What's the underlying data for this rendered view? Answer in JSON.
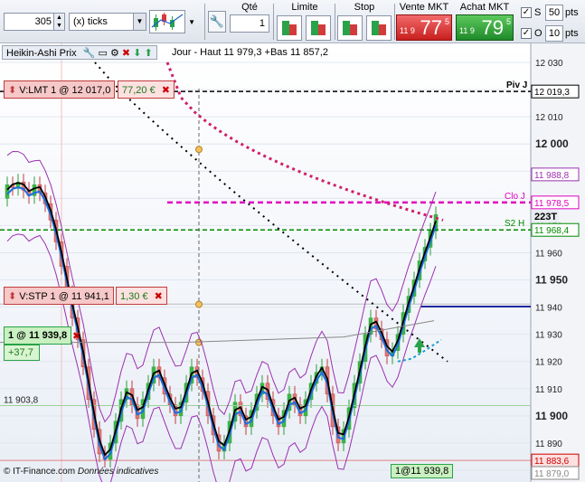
{
  "toolbar": {
    "period_value": "305",
    "period_unit": "(x) ticks",
    "qty_label": "Qté",
    "qty_value": "1",
    "limit_label": "Limite",
    "stop_label": "Stop",
    "sell_label": "Vente MKT",
    "sell_small": "11 9",
    "sell_big": "77",
    "sell_sup": "5",
    "buy_label": "Achat MKT",
    "buy_small": "11 9",
    "buy_big": "79",
    "buy_sup": "5",
    "s_label": "S",
    "s_value": "50",
    "s_unit": "pts",
    "o_label": "O",
    "o_value": "10",
    "o_unit": "pts",
    "check_mark": "✓"
  },
  "legend": {
    "title": "Heikin-Ashi Prix",
    "info": "Jour - Haut 11 979,3 +Bas 11 857,2"
  },
  "orders": {
    "lmt_text": "V:LMT  1 @ 12 017,0",
    "lmt_val": "77,20 €",
    "stp_text": "V:STP  1 @ 11 941,1",
    "stp_val": "1,30 €",
    "pos_text": "1 @ 11 939,8",
    "pos_val": "+37,7",
    "pos_badge": "1@11 939,8",
    "close_glyph": "✖"
  },
  "axis": {
    "ticks": [
      "12 030",
      "12 020",
      "12 010",
      "12 000",
      "11 990",
      "11 980",
      "11 970",
      "11 960",
      "11 950",
      "11 940",
      "11 930",
      "11 920",
      "11 910",
      "11 900",
      "11 890",
      "11 880"
    ],
    "price_tags": [
      "12 019,3",
      "11 988,8",
      "11 978,5",
      "11 968,4",
      "11 883,6",
      "11 879,0",
      "11 903,8",
      "223T"
    ],
    "line_labels": [
      "Piv J",
      "Clo J",
      "S2 H"
    ]
  },
  "footer": {
    "brand": "© IT-Finance.com",
    "note": "Données indicatives"
  },
  "colors": {
    "sell": "#d23b3b",
    "buy": "#2aa24a",
    "ha_up": "#2e9e3a",
    "ha_down": "#c23c3c",
    "pivot": "#000000",
    "clo": "#e000c0",
    "s2": "#008a00"
  }
}
